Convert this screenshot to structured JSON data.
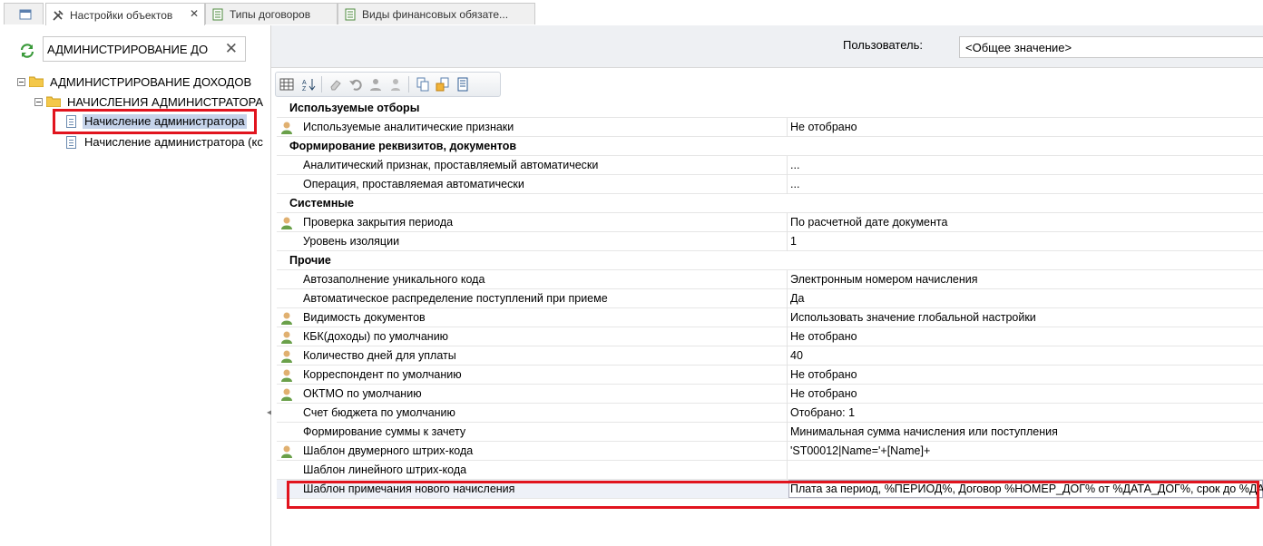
{
  "tabs": [
    {
      "label": "",
      "icon": "window-icon"
    },
    {
      "label": "Настройки объектов",
      "icon": "tools-icon",
      "close": "✕"
    },
    {
      "label": "Типы договоров",
      "icon": "table-icon"
    },
    {
      "label": "Виды финансовых обязате...",
      "icon": "table-icon"
    }
  ],
  "left": {
    "search_value": "АДМИНИСТРИРОВАНИЕ ДО",
    "clear": "✕",
    "tree": [
      {
        "label": "АДМИНИСТРИРОВАНИЕ ДОХОДОВ",
        "type": "folder"
      },
      {
        "label": "НАЧИСЛЕНИЯ АДМИНИСТРАТОРА",
        "type": "folder"
      },
      {
        "label": "Начисление администратора",
        "type": "doc",
        "selected": true
      },
      {
        "label": "Начисление администратора (кс",
        "type": "doc"
      }
    ]
  },
  "header": {
    "user_label": "Пользователь:",
    "user_value": "<Общее значение>"
  },
  "grid": {
    "rows": [
      {
        "name": "Используемые отборы",
        "group": true
      },
      {
        "name": "Используемые аналитические признаки",
        "value": "Не отобрано",
        "user": true
      },
      {
        "name": "Формирование реквизитов, документов",
        "group": true
      },
      {
        "name": "Аналитический признак, проставляемый автоматически",
        "value": "..."
      },
      {
        "name": "Операция, проставляемая автоматически",
        "value": "..."
      },
      {
        "name": "Системные",
        "group": true
      },
      {
        "name": "Проверка закрытия периода",
        "value": "По расчетной дате документа",
        "user": true
      },
      {
        "name": "Уровень изоляции",
        "value": "1"
      },
      {
        "name": "Прочие",
        "group": true
      },
      {
        "name": "Автозаполнение уникального кода",
        "value": "Электронным номером начисления"
      },
      {
        "name": "Автоматическое распределение поступлений при приеме",
        "value": "Да"
      },
      {
        "name": "Видимость документов",
        "value": "Использовать значение глобальной настройки",
        "user": true
      },
      {
        "name": "КБК(доходы) по умолчанию",
        "value": "Не отобрано",
        "user": true
      },
      {
        "name": "Количество дней для уплаты",
        "value": "40",
        "user": true
      },
      {
        "name": "Корреспондент по умолчанию",
        "value": "Не отобрано",
        "user": true
      },
      {
        "name": "ОКТМО по умолчанию",
        "value": "Не отобрано",
        "user": true
      },
      {
        "name": "Счет бюджета по умолчанию",
        "value": "Отобрано: 1"
      },
      {
        "name": "Формирование суммы к зачету",
        "value": "Минимальная сумма начисления или поступления"
      },
      {
        "name": "Шаблон двумерного штрих-кода",
        "value": "'ST00012|Name='+[Name]+",
        "user": true
      },
      {
        "name": "Шаблон линейного штрих-кода",
        "value": ""
      },
      {
        "name": "Шаблон примечания нового начисления",
        "value": "Плата за период, %ПЕРИОД%, Договор %НОМЕР_ДОГ% от %ДАТА_ДОГ%, срок до %ДАТА",
        "selected": true
      }
    ]
  },
  "colors": {
    "highlight": "#e1141e",
    "selection": "#c5d3ea"
  }
}
